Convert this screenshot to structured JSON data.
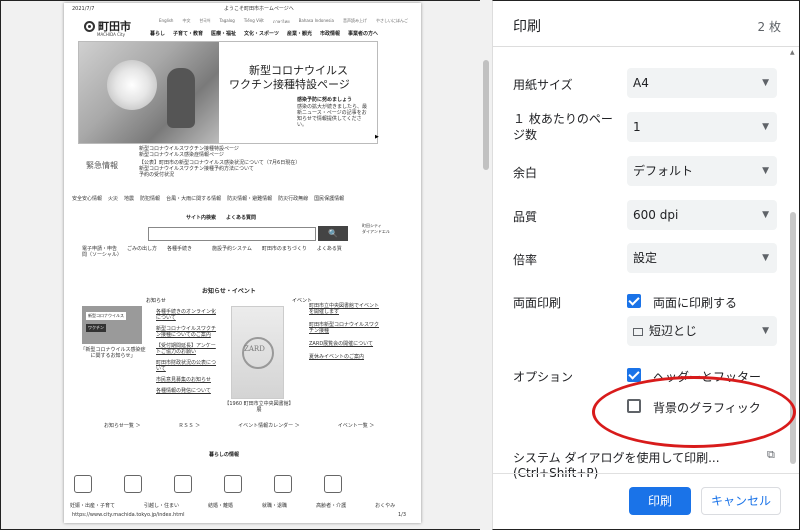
{
  "preview": {
    "date": "2021/7/7",
    "welcome": "ようこそ町田市ホームページへ",
    "logo_text": "町田市",
    "logo_sub": "MACHIDA City",
    "lang_links": [
      "English",
      "中文",
      "한국어",
      "Tagalog",
      "Tiếng Việt",
      "ภาษาไทย",
      "Bahasa Indonesia",
      "音声読み上げ",
      "やさしいにほんご"
    ],
    "nav": [
      "暮らし",
      "子育て・教育",
      "医療・福祉",
      "文化・スポーツ",
      "産業・観光",
      "市政情報",
      "事業者の方へ"
    ],
    "hero_title1": "新型コロナウイルス",
    "hero_title2": "ワクチン接種特設ページ",
    "hero_sub": "感染予防に努めましょう",
    "hero_body": "感染の拡大が続きましたら、最新ニュース・ページの記事をお知らせで情報提供してください。",
    "hero_arrow": "▶",
    "links_top": [
      "新型コロナウイルスワクチン接種特設ページ",
      "新型コロナウイルス感染症情報ページ"
    ],
    "urgent_label": "緊急情報",
    "urgent_items": [
      "【公表】町田市の新型コロナウイルス感染状況について（7月6日現在）",
      "新型コロナウイルスワクチン接種予約方法について",
      "予約の受付状況"
    ],
    "safety_label": "安全安心情報",
    "safety_items": [
      "火災",
      "地震",
      "防犯情報",
      "台風・大雨に関する情報",
      "防災情報・避難情報",
      "防災行政無線",
      "国民保護情報"
    ],
    "search_hdr": "サイト内検索　　よくある質問",
    "search_btn": "🔍",
    "search_links": "電子申請・申告　　ごみの出し方　　各種手続き　　　　施設予約システム　　町田市のまちづくり　　よくある質問（ソーシャル）",
    "right_logo": "町田シティ\nダイアンドエル",
    "news_hdr": "お知らせ・イベント",
    "news_col1": "お知らせ",
    "news_col2": "イベント",
    "news_img_label1": "新型コロナウイルス",
    "news_img_label2": "ワクチン",
    "news_img_cap": "「新型コロナウイルス感染症に関するお知らせ」",
    "news_items": [
      "各種手続きのオンライン化について",
      "新型コロナウイルスワクチン接種についてのご案内",
      "【受付期間延長】アンケートご協力のお願い",
      "町田市財政状況の公表について",
      "市民意見募集のお知らせ",
      "各種情報の発信について"
    ],
    "book_title": "ZARD",
    "book_cap": "【1960 町田市立中央図書館】展",
    "event_items": [
      "町田市立中央図書館でイベントを開催します",
      "町田市新型コロナウイルスワクチン接種",
      "ZARD展覧会の開催について",
      "夏休みイベントのご案内"
    ],
    "more_links": [
      "お知らせ一覧 ＞",
      "ＲＳＳ ＞",
      "イベント情報カレンダー ＞",
      "イベント一覧 ＞"
    ],
    "life_hdr": "暮らしの情報",
    "life_labels": [
      "妊娠・出産・子育て",
      "引越し・住まい",
      "結婚・離婚",
      "就職・退職",
      "高齢者・介護",
      "おくやみ"
    ],
    "footer_url": "https://www.city.machida.tokyo.jp/index.html",
    "footer_page": "1/3"
  },
  "panel": {
    "title": "印刷",
    "page_count": "2 枚",
    "rows": [
      {
        "label": "用紙サイズ",
        "value": "A4"
      },
      {
        "label": "１ 枚あたりのページ数",
        "value": "1"
      },
      {
        "label": "余白",
        "value": "デフォルト"
      },
      {
        "label": "品質",
        "value": "600 dpi"
      },
      {
        "label": "倍率",
        "value": "設定"
      }
    ],
    "duplex_label": "両面印刷",
    "duplex_check": "両面に印刷する",
    "duplex_checked": true,
    "binding_value": "短辺とじ",
    "options_label": "オプション",
    "header_footer": "ヘッダーとフッター",
    "header_footer_checked": true,
    "bg_graphics": "背景のグラフィック",
    "bg_graphics_checked": false,
    "system_dialog": "システム ダイアログを使用して印刷... (Ctrl+Shift+P)",
    "print_btn": "印刷",
    "cancel_btn": "キャンセル",
    "accent_color": "#1a73e8",
    "highlight_color": "#d81b1b"
  }
}
